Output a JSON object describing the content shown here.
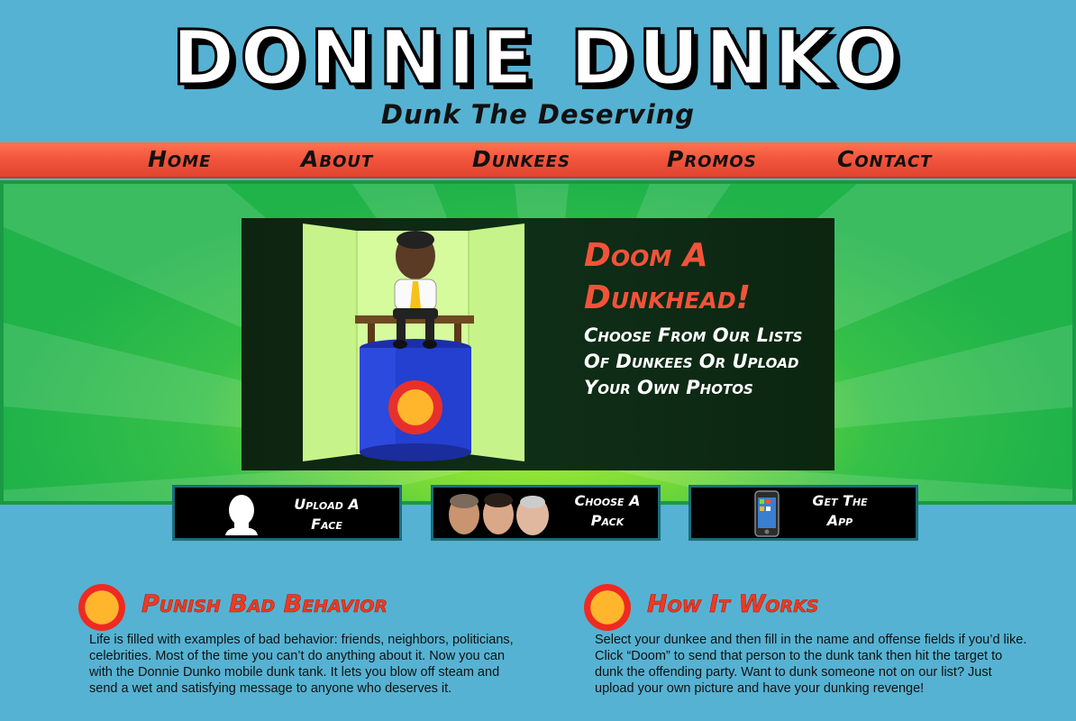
{
  "header": {
    "logo_text": "DONNIE  DUNKO",
    "tagline": "Dunk The Deserving"
  },
  "nav": {
    "items": [
      {
        "label": "Home"
      },
      {
        "label": "About"
      },
      {
        "label": "Dunkees"
      },
      {
        "label": "Promos"
      },
      {
        "label": "Contact"
      }
    ]
  },
  "hero": {
    "title": "Doom A Dunkhead!",
    "subtitle": "Choose From Our Lists Of Dunkees Or Upload Your Own Photos"
  },
  "actions": {
    "upload": {
      "label_line1": "Upload A",
      "label_line2": "Face",
      "icon": "face-silhouette-icon"
    },
    "pack": {
      "label_line1": "Choose A",
      "label_line2": "Pack",
      "icon": "face-pack-icon"
    },
    "app": {
      "label_line1": "Get The",
      "label_line2": "App",
      "icon": "smartphone-icon"
    }
  },
  "sections": [
    {
      "title": "Punish Bad Behavior",
      "body": "Life is filled with examples of bad behavior: friends, neighbors, politicians, celebrities. Most of the time you can’t do anything about it. Now you can with the Donnie Dunko mobile dunk tank.   It lets you blow off steam and send a wet and satisfying message to anyone who deserves it."
    },
    {
      "title": "How It Works",
      "body": "Select your dunkee and then fill in the name and offense fields if you’d like. Click “Doom” to send that person to the dunk tank then hit the target to dunk the offending party. Want to dunk someone not on our list? Just upload your own picture and have your dunking revenge!"
    }
  ],
  "colors": {
    "background": "#56b2d2",
    "nav": "#f0523a",
    "accent": "#ee3a22",
    "hero_green": "#20b34a"
  }
}
